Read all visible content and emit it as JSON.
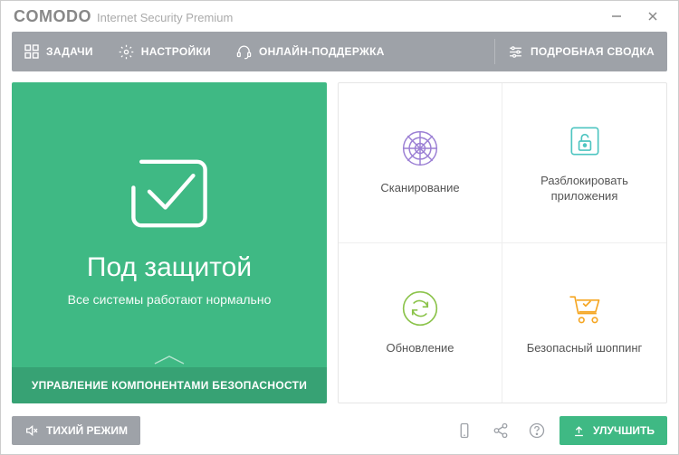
{
  "titlebar": {
    "brand": "COMODO",
    "product": "Internet Security Premium"
  },
  "toolbar": {
    "tasks": "ЗАДАЧИ",
    "settings": "НАСТРОЙКИ",
    "support": "ОНЛАЙН-ПОДДЕРЖКА",
    "summary": "ПОДРОБНАЯ СВОДКА"
  },
  "status": {
    "title": "Под защитой",
    "subtitle": "Все системы работают нормально",
    "manage": "УПРАВЛЕНИЕ КОМПОНЕНТАМИ БЕЗОПАСНОСТИ"
  },
  "tiles": {
    "scan": "Сканирование",
    "unblock": "Разблокировать приложения",
    "update": "Обновление",
    "shopping": "Безопасный шоппинг"
  },
  "footer": {
    "silent": "ТИХИЙ РЕЖИМ",
    "upgrade": "УЛУЧШИТЬ"
  },
  "colors": {
    "accent_green": "#3fb984",
    "toolbar_gray": "#9ea2a8",
    "icon_purple": "#9b7fd4",
    "icon_teal": "#4ec5c1",
    "icon_orange": "#f5a623"
  }
}
